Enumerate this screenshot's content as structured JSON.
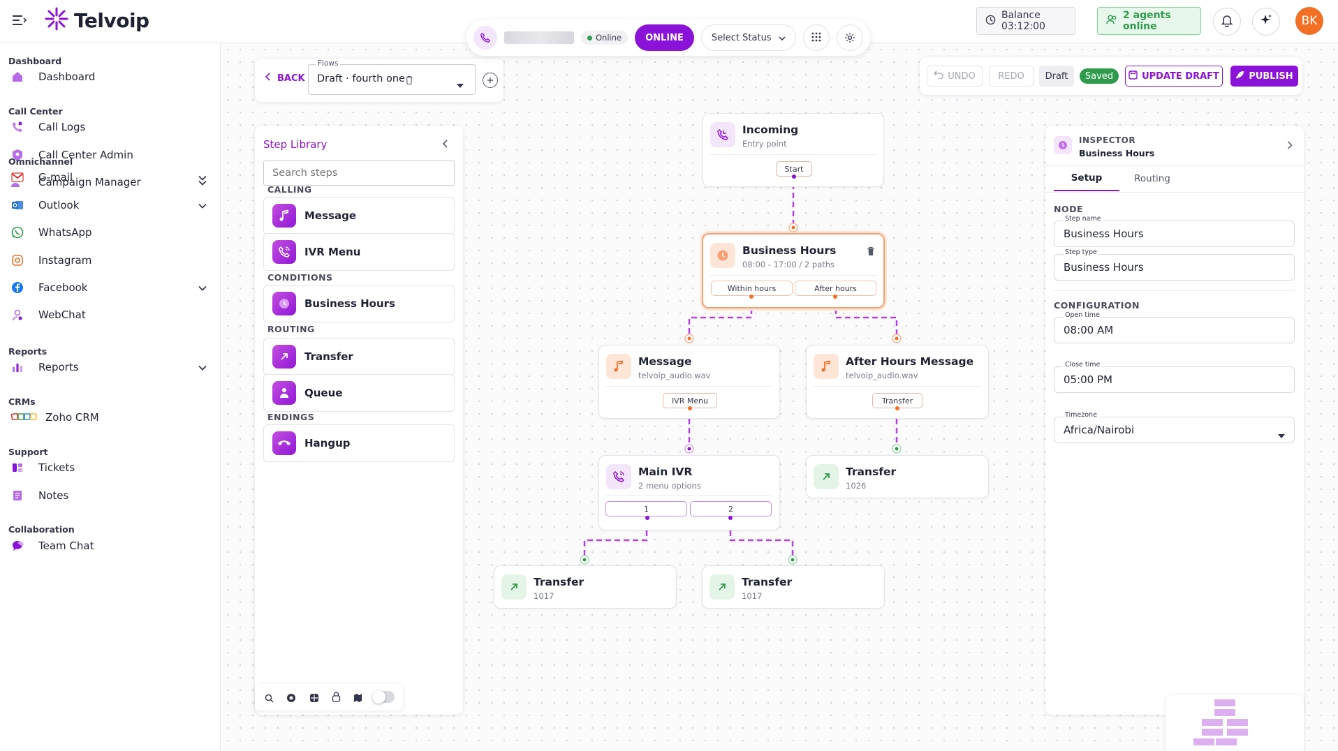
{
  "app": {
    "name": "Telvoip"
  },
  "topbar": {
    "balance_label": "Balance 03:12:00",
    "agents_label": "2 agents online",
    "avatar_initials": "BK"
  },
  "status": {
    "presence": "Online",
    "online_button": "ONLINE",
    "select_status": "Select Status"
  },
  "sidebar": {
    "sections": [
      {
        "title": "Dashboard",
        "items": [
          {
            "label": "Dashboard",
            "icon": "home-icon"
          }
        ]
      },
      {
        "title": "Call Center",
        "items": [
          {
            "label": "Call Logs",
            "icon": "phone-log-icon"
          },
          {
            "label": "Call Center Admin",
            "icon": "shield-icon"
          },
          {
            "label": "Campaign Manager",
            "icon": "users-icon",
            "expandable": true
          }
        ]
      },
      {
        "title": "Omnichannel",
        "items": [
          {
            "label": "G-mail",
            "icon": "gmail-icon",
            "expandable": true
          },
          {
            "label": "Outlook",
            "icon": "outlook-icon",
            "expandable": true
          },
          {
            "label": "WhatsApp",
            "icon": "whatsapp-icon"
          },
          {
            "label": "Instagram",
            "icon": "instagram-icon"
          },
          {
            "label": "Facebook",
            "icon": "facebook-icon",
            "expandable": true
          },
          {
            "label": "WebChat",
            "icon": "webchat-icon"
          }
        ]
      },
      {
        "title": "Reports",
        "items": [
          {
            "label": "Reports",
            "icon": "bar-chart-icon",
            "expandable": true
          }
        ]
      },
      {
        "title": "CRMs",
        "items": [
          {
            "label": "Zoho CRM",
            "icon": "zoho-icon"
          }
        ]
      },
      {
        "title": "Support",
        "items": [
          {
            "label": "Tickets",
            "icon": "ticket-icon"
          },
          {
            "label": "Notes",
            "icon": "notes-icon"
          }
        ]
      },
      {
        "title": "Collaboration",
        "items": [
          {
            "label": "Team Chat",
            "icon": "chat-icon"
          }
        ]
      }
    ]
  },
  "flowbar": {
    "back_label": "BACK",
    "flows_label": "Flows",
    "flow_value": "Draft · fourth one"
  },
  "toolbar": {
    "undo": "UNDO",
    "redo": "REDO",
    "draft_badge": "Draft",
    "saved_badge": "Saved",
    "update_draft": "UPDATE DRAFT",
    "publish": "PUBLISH"
  },
  "library": {
    "title": "Step Library",
    "search_placeholder": "Search steps",
    "sections": [
      {
        "title": "CALLING",
        "items": [
          {
            "label": "Message",
            "icon": "music-note-icon"
          },
          {
            "label": "IVR Menu",
            "icon": "ivr-phone-icon"
          }
        ]
      },
      {
        "title": "CONDITIONS",
        "items": [
          {
            "label": "Business Hours",
            "icon": "clock-icon"
          }
        ]
      },
      {
        "title": "ROUTING",
        "items": [
          {
            "label": "Transfer",
            "icon": "arrow-up-right-icon"
          },
          {
            "label": "Queue",
            "icon": "queue-icon"
          }
        ]
      },
      {
        "title": "ENDINGS",
        "items": [
          {
            "label": "Hangup",
            "icon": "hangup-icon"
          }
        ]
      }
    ]
  },
  "nodes": {
    "incoming": {
      "title": "Incoming",
      "subtitle": "Entry point",
      "port": "Start"
    },
    "business_hours": {
      "title": "Business Hours",
      "subtitle": "08:00 - 17:00 / 2 paths",
      "port_a": "Within hours",
      "port_b": "After hours"
    },
    "message": {
      "title": "Message",
      "subtitle": "telvoip_audio.wav",
      "port": "IVR Menu"
    },
    "after_hours": {
      "title": "After Hours Message",
      "subtitle": "telvoip_audio.wav",
      "port": "Transfer"
    },
    "main_ivr": {
      "title": "Main IVR",
      "subtitle": "2 menu options",
      "port_a": "1",
      "port_b": "2"
    },
    "transfer_right": {
      "title": "Transfer",
      "subtitle": "1026"
    },
    "transfer_1": {
      "title": "Transfer",
      "subtitle": "1017"
    },
    "transfer_2": {
      "title": "Transfer",
      "subtitle": "1017"
    }
  },
  "inspector": {
    "label": "INSPECTOR",
    "subtitle": "Business Hours",
    "tabs": [
      "Setup",
      "Routing"
    ],
    "active_tab": "Setup",
    "node_section": "NODE",
    "step_name_label": "Step name",
    "step_name": "Business Hours",
    "step_type_label": "Step type",
    "step_type": "Business Hours",
    "config_section": "CONFIGURATION",
    "open_time_label": "Open time",
    "open_time": "08:00 AM",
    "close_time_label": "Close time",
    "close_time": "05:00 PM",
    "timezone_label": "Timezone",
    "timezone": "Africa/Nairobi"
  },
  "colors": {
    "brand": "#8a12d9",
    "accent_orange": "#f36f24",
    "saved_green": "#2e9b4c",
    "edge": "#b53ee6"
  }
}
